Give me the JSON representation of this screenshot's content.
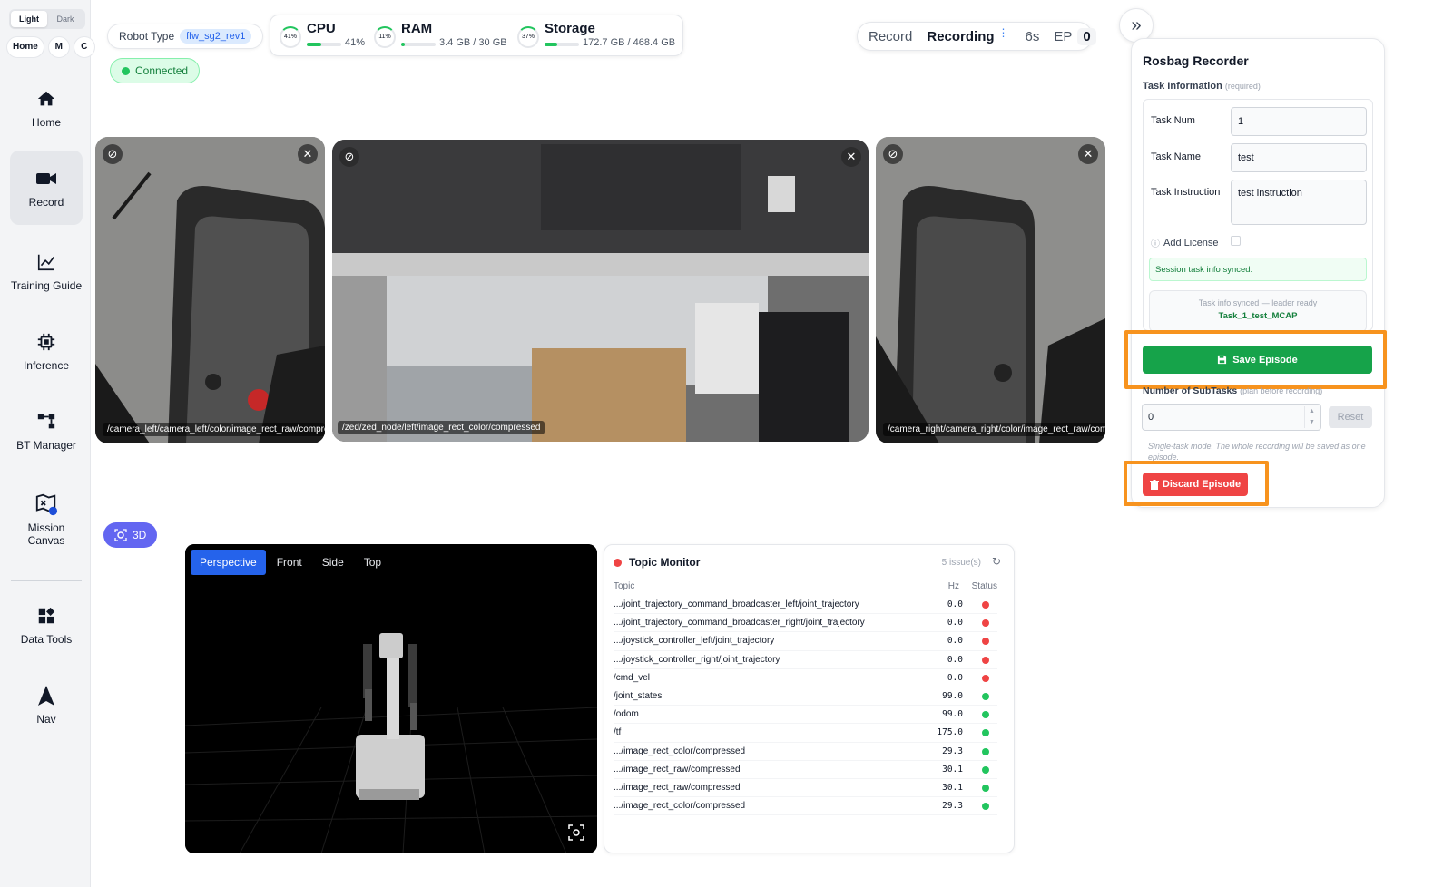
{
  "sidebar": {
    "theme": {
      "light": "Light",
      "dark": "Dark"
    },
    "mini": {
      "home": "Home",
      "m": "M",
      "c": "C"
    },
    "items": [
      {
        "label": "Home",
        "icon": "home-icon"
      },
      {
        "label": "Record",
        "icon": "video-camera-icon"
      },
      {
        "label": "Training Guide",
        "icon": "chart-line-icon"
      },
      {
        "label": "Inference",
        "icon": "chip-icon"
      },
      {
        "label": "BT Manager",
        "icon": "tree-icon"
      },
      {
        "label": "Mission Canvas",
        "icon": "map-icon"
      },
      {
        "label": "Data Tools",
        "icon": "grid-icon"
      },
      {
        "label": "Nav",
        "icon": "navigation-arrow-icon"
      }
    ]
  },
  "header": {
    "robot_type_label": "Robot Type",
    "robot_type_value": "ffw_sg2_rev1",
    "connection": "Connected",
    "cpu": {
      "name": "CPU",
      "ring": "41%",
      "value": "41%",
      "fraction": 0.41
    },
    "ram": {
      "name": "RAM",
      "ring": "11%",
      "value": "3.4 GB / 30 GB",
      "fraction": 0.11
    },
    "storage": {
      "name": "Storage",
      "ring": "37%",
      "value": "172.7 GB / 468.4 GB",
      "fraction": 0.37
    },
    "record": {
      "label": "Record",
      "status": "Recording",
      "time": "6s",
      "ep_label": "EP",
      "ep_value": "0"
    }
  },
  "cameras": [
    {
      "topic": "/camera_left/camera_left/color/image_rect_raw/compressed"
    },
    {
      "topic": "/zed/zed_node/left/image_rect_color/compressed"
    },
    {
      "topic": "/camera_right/camera_right/color/image_rect_raw/compressed"
    }
  ],
  "viewer": {
    "toggle": "3D",
    "tabs": [
      "Perspective",
      "Front",
      "Side",
      "Top"
    ]
  },
  "topic_monitor": {
    "title": "Topic Monitor",
    "issues": "5 issue(s)",
    "col_topic": "Topic",
    "col_hz": "Hz",
    "col_status": "Status",
    "rows": [
      {
        "topic": ".../joint_trajectory_command_broadcaster_left/joint_trajectory",
        "hz": "0.0",
        "status": "error"
      },
      {
        "topic": ".../joint_trajectory_command_broadcaster_right/joint_trajectory",
        "hz": "0.0",
        "status": "error"
      },
      {
        "topic": ".../joystick_controller_left/joint_trajectory",
        "hz": "0.0",
        "status": "error"
      },
      {
        "topic": ".../joystick_controller_right/joint_trajectory",
        "hz": "0.0",
        "status": "error"
      },
      {
        "topic": "/cmd_vel",
        "hz": "0.0",
        "status": "error"
      },
      {
        "topic": "/joint_states",
        "hz": "99.0",
        "status": "ok"
      },
      {
        "topic": "/odom",
        "hz": "99.0",
        "status": "ok"
      },
      {
        "topic": "/tf",
        "hz": "175.0",
        "status": "ok"
      },
      {
        "topic": ".../image_rect_color/compressed",
        "hz": "29.3",
        "status": "ok"
      },
      {
        "topic": ".../image_rect_raw/compressed",
        "hz": "30.1",
        "status": "ok"
      },
      {
        "topic": ".../image_rect_raw/compressed",
        "hz": "30.1",
        "status": "ok"
      },
      {
        "topic": ".../image_rect_color/compressed",
        "hz": "29.3",
        "status": "ok"
      }
    ]
  },
  "recorder": {
    "title": "Rosbag Recorder",
    "section": "Task Information",
    "required": "(required)",
    "task_num_label": "Task Num",
    "task_num_value": "1",
    "task_name_label": "Task Name",
    "task_name_value": "test",
    "task_instruction_label": "Task Instruction",
    "task_instruction_value": "test instruction",
    "add_license_label": "Add License",
    "synced_message": "Session task info synced.",
    "leader_status": "Task info synced — leader ready",
    "task_id": "Task_1_test_MCAP",
    "save_label": "Save Episode",
    "subtasks_label": "Number of SubTasks",
    "subtasks_hint": "(plan before recording)",
    "subtasks_value": "0",
    "reset_label": "Reset",
    "single_note": "Single-task mode. The whole recording will be saved as one episode.",
    "discard_label": "Discard Episode"
  },
  "colors": {
    "ok": "#22c55e",
    "error": "#ef4444",
    "accent": "#2563eb",
    "save": "#16a34a",
    "discard": "#ef4444",
    "highlight": "#f7931e"
  }
}
